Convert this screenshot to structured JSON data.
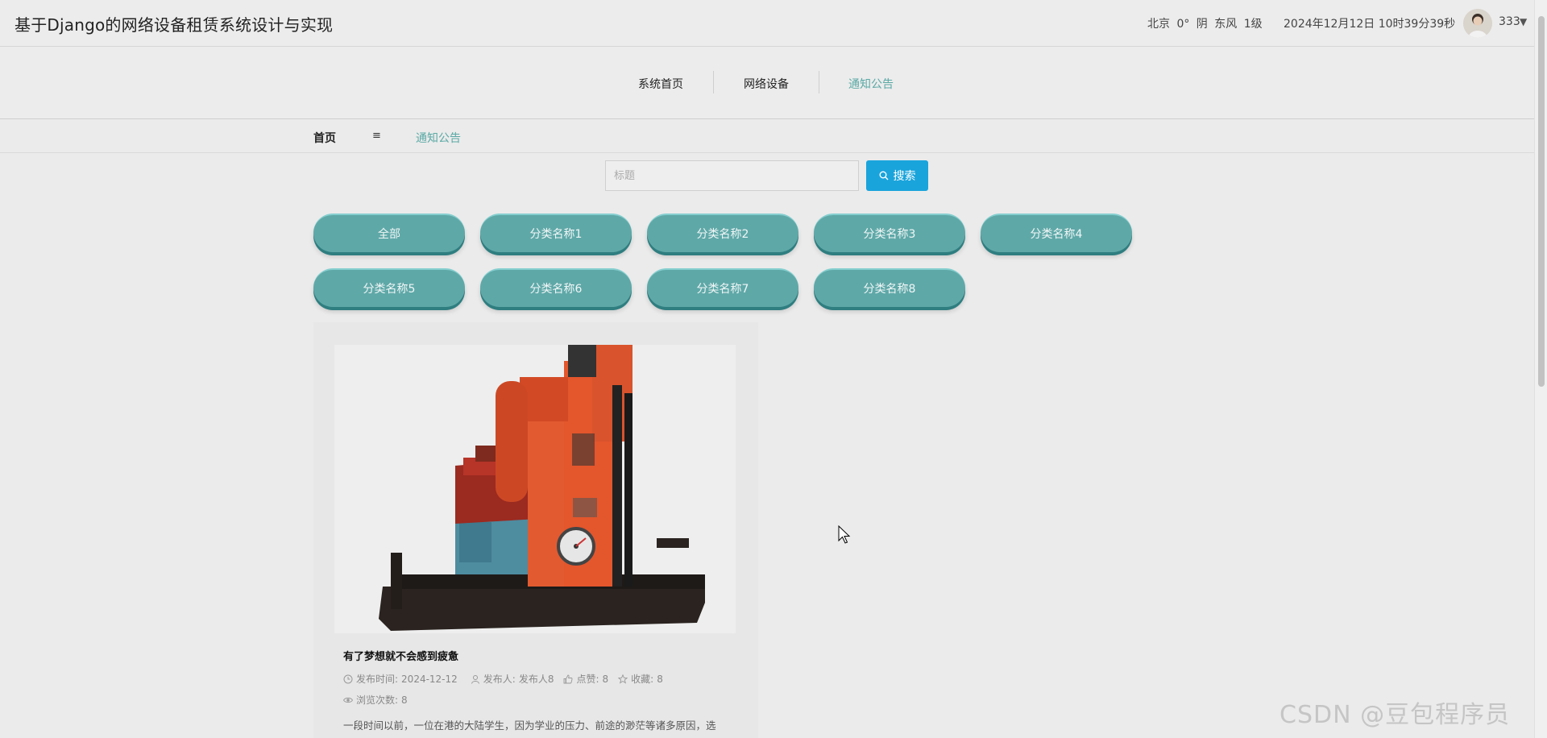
{
  "header": {
    "site_title": "基于Django的网络设备租赁系统设计与实现",
    "weather": "北京  0°  阴  东风  1级",
    "datetime": "2024年12月12日 10时39分39秒",
    "username": "333",
    "caret": "▼"
  },
  "nav": {
    "items": [
      {
        "label": "系统首页"
      },
      {
        "label": "网络设备"
      },
      {
        "label": "通知公告"
      }
    ],
    "active_index": 2
  },
  "breadcrumb": {
    "home": "首页",
    "separator": "≡",
    "current": "通知公告"
  },
  "search": {
    "placeholder": "标题",
    "value": "",
    "button_label": "搜索"
  },
  "categories": [
    "全部",
    "分类名称1",
    "分类名称2",
    "分类名称3",
    "分类名称4",
    "分类名称5",
    "分类名称6",
    "分类名称7",
    "分类名称8"
  ],
  "article": {
    "title": "有了梦想就不会感到疲惫",
    "publish_label": "发布时间:",
    "publish_date": "2024-12-12",
    "author_label": "发布人:",
    "author": "发布人8",
    "likes_label": "点赞:",
    "likes": "8",
    "favorites_label": "收藏:",
    "favorites": "8",
    "views_label": "浏览次数:",
    "views": "8",
    "excerpt": "一段时间以前，一位在港的大陆学生，因为学业的压力、前途的渺茫等诸多原因，选"
  },
  "watermark": "CSDN @豆包程序员",
  "colors": {
    "accent": "#5aa9a5",
    "search_button": "#1aa4dc",
    "category_pill": "#5fa8a8"
  }
}
